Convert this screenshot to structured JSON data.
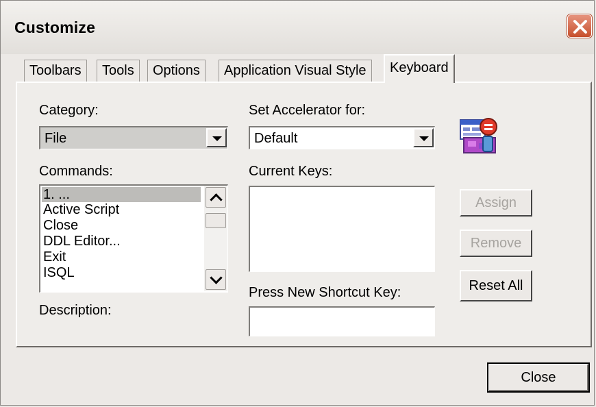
{
  "window": {
    "title": "Customize"
  },
  "tabs": [
    {
      "label": "Toolbars",
      "active": false
    },
    {
      "label": "Tools",
      "active": false
    },
    {
      "label": "Options",
      "active": false
    },
    {
      "label": "Application Visual Style",
      "active": false
    },
    {
      "label": "Keyboard",
      "active": true
    }
  ],
  "category": {
    "label": "Category:",
    "value": "File"
  },
  "accelerator": {
    "label": "Set Accelerator for:",
    "value": "Default"
  },
  "commands": {
    "label": "Commands:",
    "items": [
      "1. ...",
      "Active Script",
      "Close",
      "DDL Editor...",
      "Exit",
      "ISQL"
    ],
    "selected_index": 0
  },
  "current_keys": {
    "label": "Current Keys:",
    "value": ""
  },
  "new_shortcut": {
    "label": "Press New Shortcut Key:",
    "value": ""
  },
  "description": {
    "label": "Description:"
  },
  "buttons": {
    "assign": "Assign",
    "remove": "Remove",
    "reset_all": "Reset All",
    "close": "Close"
  },
  "icons": {
    "app": "keyboard-customize-icon",
    "close": "close-icon",
    "scroll_up": "chevron-up-icon",
    "scroll_down": "chevron-down-icon",
    "dropdown": "dropdown-arrow-icon"
  },
  "colors": {
    "close_button": "#c7502d",
    "selection": "#bdbcb9",
    "dialog_bg": "#ece9e6"
  }
}
